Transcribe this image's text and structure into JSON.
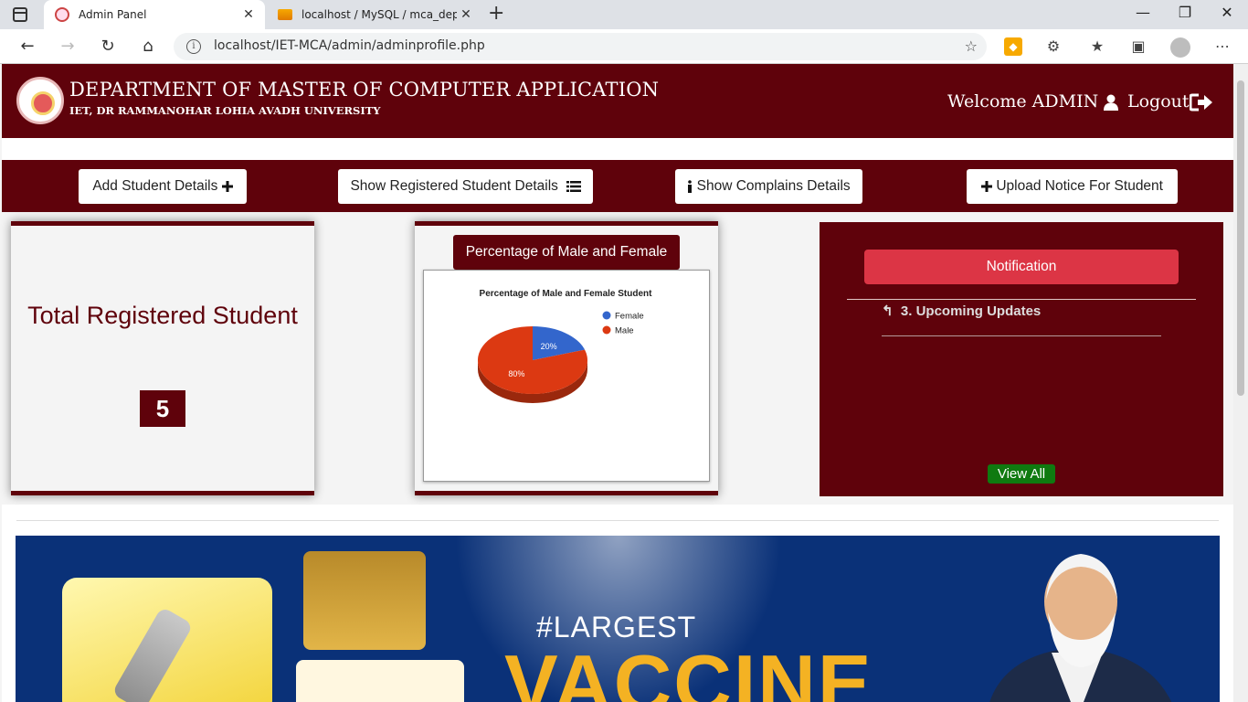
{
  "browser": {
    "tabs": [
      {
        "title": "Admin Panel",
        "active": true
      },
      {
        "title": "localhost / MySQL / mca_dept / c",
        "active": false
      }
    ],
    "url": "localhost/IET-MCA/admin/adminprofile.php",
    "colors": {
      "tabbar": "#dee1e6"
    }
  },
  "header": {
    "title": "DEPARTMENT OF MASTER OF COMPUTER APPLICATION",
    "subtitle": "IET, DR RAMMANOHAR LOHIA AVADH UNIVERSITY",
    "welcome": "Welcome ADMIN",
    "logout": "Logout",
    "colors": {
      "brand": "#5f020b"
    }
  },
  "actions": {
    "add_student": "Add Student Details",
    "show_registered": "Show Registered Student Details",
    "show_complains": "Show Complains Details",
    "upload_notice": "Upload Notice For Student"
  },
  "stats": {
    "total_title": "Total Registered Student",
    "total_count": "5"
  },
  "gender_card": {
    "label": "Percentage of Male and Female"
  },
  "chart_data": {
    "type": "pie",
    "title": "Percentage of Male and Female Student",
    "categories": [
      "Female",
      "Male"
    ],
    "values": [
      20,
      80
    ],
    "labels": [
      "20%",
      "80%"
    ],
    "colors": [
      "#3366cc",
      "#dc3912"
    ],
    "legend": "right",
    "three_d": true
  },
  "notification": {
    "button": "Notification",
    "items": [
      {
        "text": "3. Upcoming Updates"
      }
    ],
    "view_all": "View All"
  },
  "banner": {
    "hashtag": "#LARGEST",
    "headline": "VACCINE",
    "colors": {
      "bg": "#0a3178",
      "headline": "#f4b223"
    }
  }
}
